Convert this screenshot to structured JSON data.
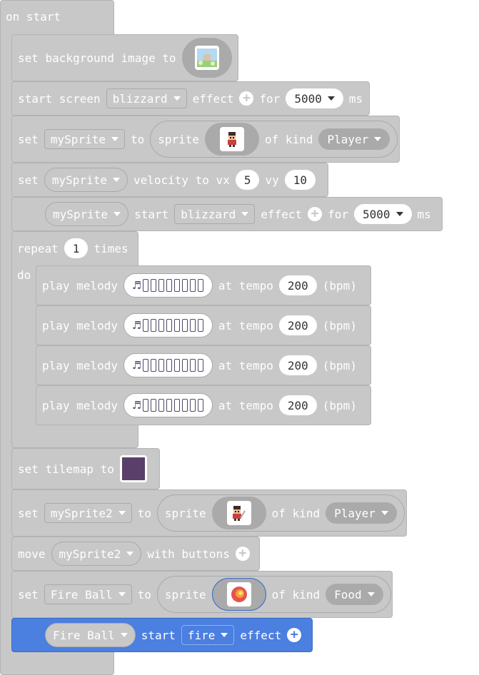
{
  "hat": {
    "label": "on start"
  },
  "blocks": {
    "bg": {
      "label": "set background image to"
    },
    "screen": {
      "label": "start screen",
      "effect": "blizzard",
      "effect_label": "effect",
      "for_label": "for",
      "duration": "5000",
      "unit": "ms"
    },
    "setSprite1": {
      "set": "set",
      "variable": "mySprite",
      "to": "to",
      "sprite": "sprite",
      "of_kind": "of kind",
      "kind": "Player"
    },
    "velocity": {
      "set": "set",
      "variable": "mySprite",
      "label": "velocity to vx",
      "vx": "5",
      "vy_label": "vy",
      "vy": "10"
    },
    "spriteEffect": {
      "variable": "mySprite",
      "start": "start",
      "effect": "blizzard",
      "effect_label": "effect",
      "for_label": "for",
      "duration": "5000",
      "unit": "ms"
    },
    "repeat": {
      "label": "repeat",
      "count": "1",
      "times": "times",
      "do": "do"
    },
    "melody": {
      "play": "play melody",
      "at_tempo": "at tempo",
      "tempo": "200",
      "bpm": "(bpm)"
    },
    "tilemap": {
      "label": "set tilemap to"
    },
    "setSprite2": {
      "set": "set",
      "variable": "mySprite2",
      "to": "to",
      "sprite": "sprite",
      "of_kind": "of kind",
      "kind": "Player"
    },
    "move": {
      "label": "move",
      "variable": "mySprite2",
      "with": "with buttons"
    },
    "setFire": {
      "set": "set",
      "variable": "Fire Ball",
      "to": "to",
      "sprite": "sprite",
      "of_kind": "of kind",
      "kind": "Food"
    },
    "fireEffect": {
      "variable": "Fire Ball",
      "start": "start",
      "effect": "fire",
      "effect_label": "effect"
    }
  },
  "colors": {
    "block_gray": "#c8c8c8",
    "selected_blue": "#4b7fe0",
    "tilemap": "#5a3f6a"
  }
}
